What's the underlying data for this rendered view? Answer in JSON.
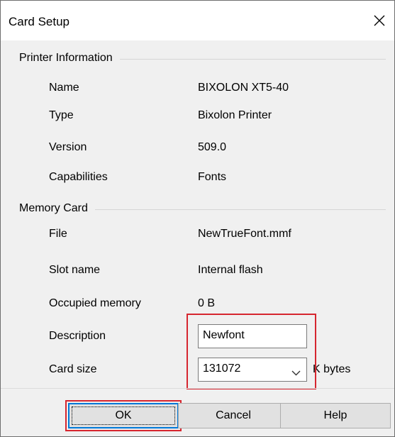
{
  "window": {
    "title": "Card Setup"
  },
  "printer_info": {
    "heading": "Printer Information",
    "rows": [
      {
        "label": "Name",
        "value": "BIXOLON XT5-40"
      },
      {
        "label": "Type",
        "value": "Bixolon Printer"
      },
      {
        "label": "Version",
        "value": "509.0"
      },
      {
        "label": "Capabilities",
        "value": "Fonts"
      }
    ]
  },
  "memory_card": {
    "heading": "Memory Card",
    "rows": [
      {
        "label": "File",
        "value": "NewTrueFont.mmf"
      },
      {
        "label": "Slot name",
        "value": "Internal flash"
      },
      {
        "label": "Occupied memory",
        "value": "0 B"
      }
    ],
    "description_label": "Description",
    "description_value": "Newfont",
    "card_size_label": "Card size",
    "card_size_value": "131072",
    "card_size_unit": "K bytes"
  },
  "buttons": {
    "ok": "OK",
    "cancel": "Cancel",
    "help": "Help"
  },
  "colors": {
    "highlight": "#d6262f",
    "focus_border": "#0078d7",
    "dialog_bg": "#f0f0f0"
  }
}
